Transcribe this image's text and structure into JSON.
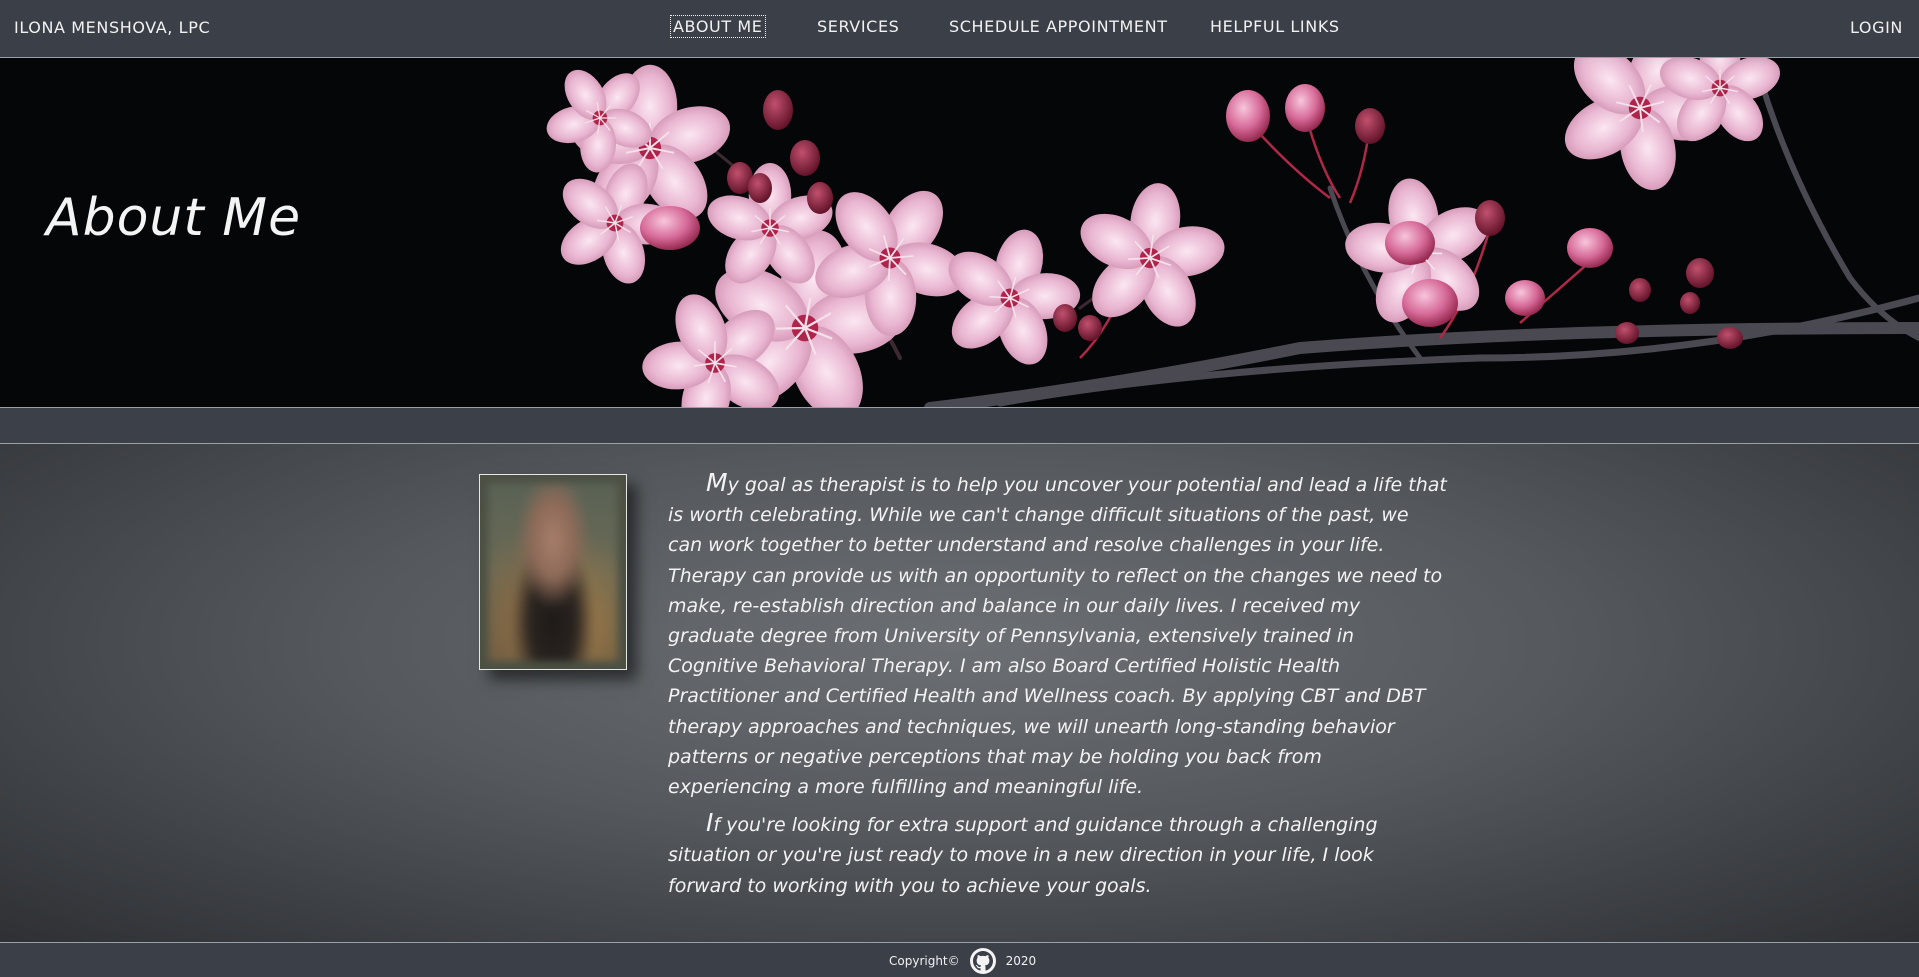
{
  "navbar": {
    "brand": "ILONA MENSHOVA, LPC",
    "links": [
      "ABOUT ME",
      "SERVICES",
      "SCHEDULE APPOINTMENT",
      "HELPFUL LINKS"
    ],
    "active_link": "ABOUT ME",
    "login_label": "LOGIN"
  },
  "hero": {
    "title": "About Me"
  },
  "bio": {
    "paragraphs": [
      "My goal as therapist is to help you uncover your potential and lead a life that is worth celebrating. While we can't change difficult situations of the past, we can work together to better understand and resolve challenges in your life. Therapy can provide us with an opportunity to reflect on the changes we need to make, re-establish direction and balance in our daily lives.  I received my graduate degree from University of Pennsylvania, extensively trained in Cognitive Behavioral Therapy. I am also Board Certified Holistic Health Practitioner and Certified Health and Wellness coach. By applying CBT and DBT therapy approaches and techniques, we will unearth long-standing behavior patterns or negative perceptions that may be holding you back from experiencing a more fulfilling and meaningful life.",
      "If you're looking for extra support and guidance through a challenging situation or you're just ready to move in a new direction in your life, I look forward to working with you to achieve your goals."
    ]
  },
  "footer": {
    "copyright": "Copyright©",
    "year": "2020",
    "icon": "github-icon"
  },
  "colors": {
    "navbar_bg": "#3b3f48",
    "hero_bg": "#050608",
    "blossom": "#f0c8e0",
    "blossom_dark": "#8a1f3c",
    "text": "#f3f3f3"
  }
}
